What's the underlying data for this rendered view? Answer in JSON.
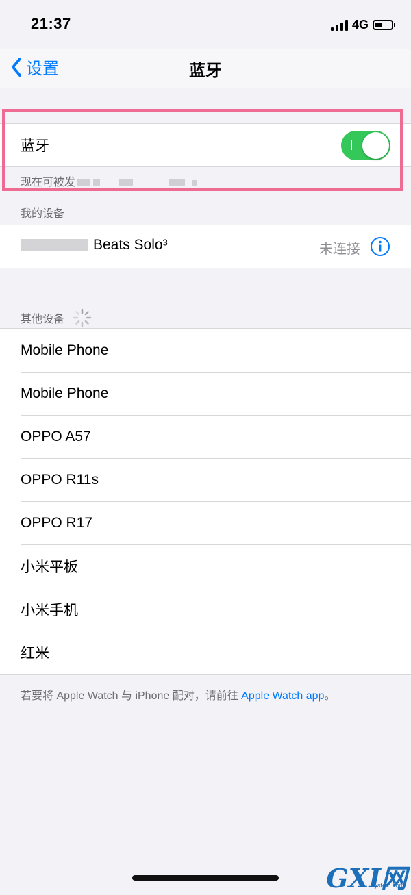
{
  "status_bar": {
    "time": "21:37",
    "network": "4G"
  },
  "nav": {
    "back_label": "设置",
    "title": "蓝牙"
  },
  "bluetooth": {
    "label": "蓝牙",
    "enabled": true,
    "discoverable_prefix": "现在可被发"
  },
  "my_devices": {
    "header": "我的设备",
    "items": [
      {
        "name": "Beats Solo³",
        "status": "未连接"
      }
    ]
  },
  "other_devices": {
    "header": "其他设备",
    "items": [
      "Mobile Phone",
      "Mobile Phone",
      "OPPO A57",
      "OPPO R11s",
      "OPPO R17",
      "小米平板",
      "小米手机",
      "红米"
    ]
  },
  "footer": {
    "text": "若要将 Apple Watch 与 iPhone 配对，请前往 ",
    "link": "Apple Watch app",
    "suffix": "。"
  },
  "watermark": {
    "logo": "GXI网",
    "domain": "system.com"
  },
  "colors": {
    "accent": "#007aff",
    "toggle_on": "#34c759",
    "highlight": "#ee6b93"
  }
}
